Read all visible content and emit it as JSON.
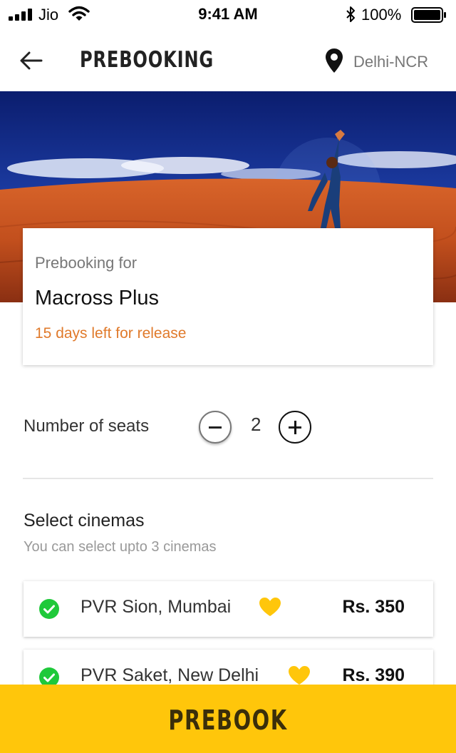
{
  "status_bar": {
    "carrier": "Jio",
    "time": "9:41 AM",
    "battery": "100%",
    "icons": [
      "signal-icon",
      "wifi-icon",
      "bluetooth-icon",
      "battery-icon"
    ]
  },
  "header": {
    "title": "PREBOOKING",
    "location": "Delhi-NCR",
    "icons": [
      "back-arrow-icon",
      "location-pin-icon"
    ]
  },
  "movie": {
    "caption": "Prebooking for",
    "title": "Macross Plus",
    "release_note": "15 days left for release"
  },
  "seats": {
    "label": "Number of seats",
    "count": "2"
  },
  "cinemas": {
    "title": "Select cinemas",
    "subtitle": "You can select upto 3 cinemas",
    "items": [
      {
        "name": "PVR Sion, Mumbai",
        "price": "Rs. 350",
        "selected": true,
        "favorite": true
      },
      {
        "name": "PVR Saket, New Delhi",
        "price": "Rs. 390",
        "selected": true,
        "favorite": true
      }
    ]
  },
  "cta": {
    "label": "PREBOOK"
  },
  "colors": {
    "accent": "#ffc60b",
    "release_text": "#e07a2b",
    "check_green": "#1fc93a",
    "heart_yellow": "#ffc60b"
  }
}
